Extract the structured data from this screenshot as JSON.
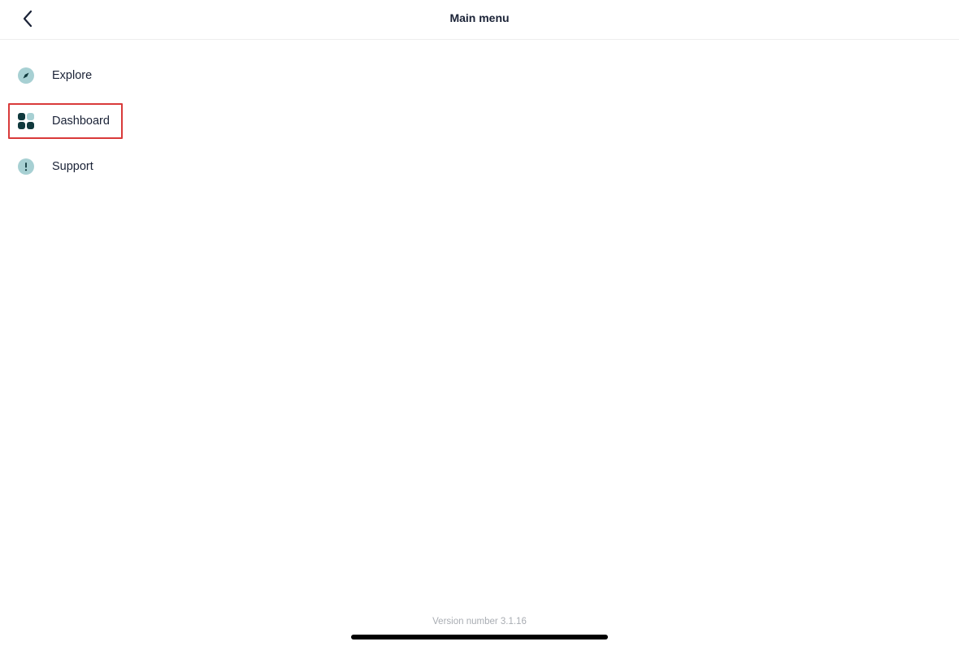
{
  "header": {
    "title": "Main menu",
    "back_icon": "chevron-left-icon"
  },
  "menu": {
    "items": [
      {
        "label": "Explore",
        "icon": "compass-icon",
        "highlighted": false
      },
      {
        "label": "Dashboard",
        "icon": "dashboard-grid-icon",
        "highlighted": true
      },
      {
        "label": "Support",
        "icon": "exclamation-circle-icon",
        "highlighted": false
      }
    ]
  },
  "footer": {
    "version": "Version number 3.1.16"
  },
  "colors": {
    "text_dark": "#1a2236",
    "icon_dark": "#10393d",
    "icon_light": "#a7d0d3",
    "highlight_border": "#d93a3a",
    "version_text": "#a9adb3"
  }
}
